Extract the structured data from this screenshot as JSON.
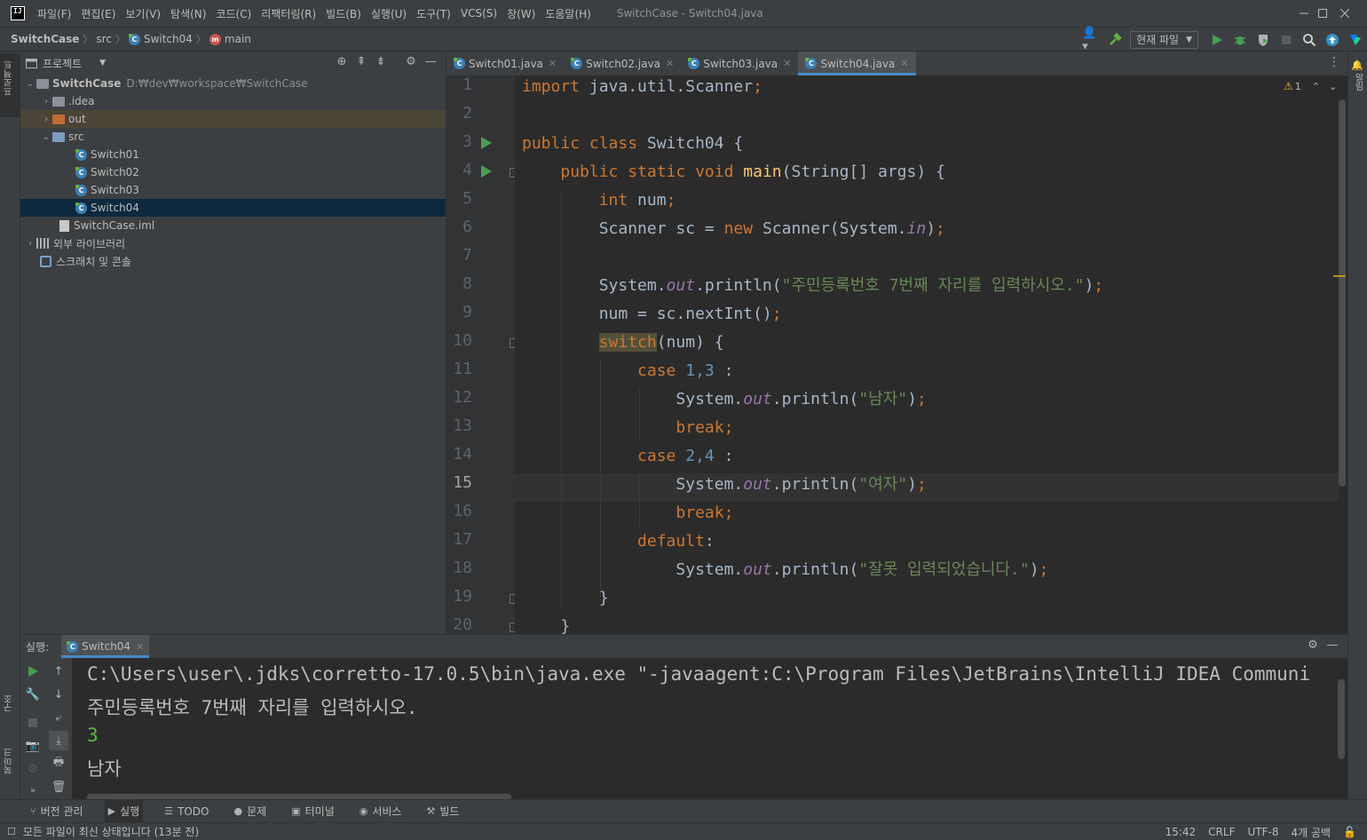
{
  "window": {
    "title": "SwitchCase - Switch04.java",
    "menu": [
      "파일(F)",
      "편집(E)",
      "보기(V)",
      "탐색(N)",
      "코드(C)",
      "리팩터링(R)",
      "빌드(B)",
      "실행(U)",
      "도구(T)",
      "VCS(S)",
      "창(W)",
      "도움말(H)"
    ]
  },
  "breadcrumb": {
    "project": "SwitchCase",
    "folder": "src",
    "class": "Switch04",
    "method": "main"
  },
  "toolbar": {
    "run_config": "현재 파일"
  },
  "project_panel": {
    "title": "프로젝트",
    "root_name": "SwitchCase",
    "root_path": "D:₩dev₩workspace₩SwitchCase",
    "items": {
      "idea": ".idea",
      "out": "out",
      "src": "src",
      "s1": "Switch01",
      "s2": "Switch02",
      "s3": "Switch03",
      "s4": "Switch04",
      "iml": "SwitchCase.iml",
      "libs": "외부 라이브러리",
      "scratch": "스크래치 및 콘솔"
    }
  },
  "left_stripe": {
    "project": "프로젝트",
    "structure": "구조",
    "bookmarks": "북마크"
  },
  "right_stripe": {
    "notifications": "알림"
  },
  "editor": {
    "tabs": [
      "Switch01.java",
      "Switch02.java",
      "Switch03.java",
      "Switch04.java"
    ],
    "active_tab": "Switch04.java",
    "warnings": "1",
    "current_line": 15,
    "line_numbers": [
      "1",
      "2",
      "3",
      "4",
      "5",
      "6",
      "7",
      "8",
      "9",
      "10",
      "11",
      "12",
      "13",
      "14",
      "15",
      "16",
      "17",
      "18",
      "19",
      "20"
    ],
    "code": {
      "l1_kw": "import",
      "l1_rest": " java.util.Scanner",
      "l1_semi": ";",
      "l3_kw": "public class",
      "l3_rest": " Switch04 {",
      "l4_kw": "public static void",
      "l4_fn": "main",
      "l4_rest": "(String[] args) {",
      "l5_kw": "int",
      "l5_rest": " num",
      "l6_a": "Scanner sc = ",
      "l6_kw": "new",
      "l6_b": " Scanner(System.",
      "l6_fld": "in",
      "l6_c": ")",
      "sys": "System.",
      "out": "out",
      "println": ".println(",
      "l8_str": "\"주민등록번호 7번째 자리를 입력하시오.\"",
      "close": ")",
      "semi": ";",
      "l9": "num = sc.nextInt()",
      "l10_kw": "switch",
      "l10_rest": "(num) {",
      "l11_kw": "case",
      "l11_num": " 1,3",
      "colon": " :",
      "l12_str": "\"남자\"",
      "brk": "break",
      "l14_num": " 2,4",
      "l15_str": "\"여자\"",
      "l17_kw": "default",
      "l17_colon": ":",
      "l18_str": "\"잘못 입력되었습니다.\"",
      "l19": "}",
      "l20": "}"
    }
  },
  "run_panel": {
    "label": "실행:",
    "tab": "Switch04",
    "console": [
      "C:\\Users\\user\\.jdks\\corretto-17.0.5\\bin\\java.exe \"-javaagent:C:\\Program Files\\JetBrains\\IntelliJ IDEA Communi",
      "주민등록번호 7번째 자리를 입력하시오.",
      "3",
      "남자"
    ]
  },
  "bottom_tools": [
    "버전 관리",
    "실행",
    "TODO",
    "문제",
    "터미널",
    "서비스",
    "빌드"
  ],
  "status": {
    "message": "모든 파일이 최신 상태입니다 (13분 전)",
    "position": "15:42",
    "line_sep": "CRLF",
    "encoding": "UTF-8",
    "indent": "4개 공백"
  }
}
